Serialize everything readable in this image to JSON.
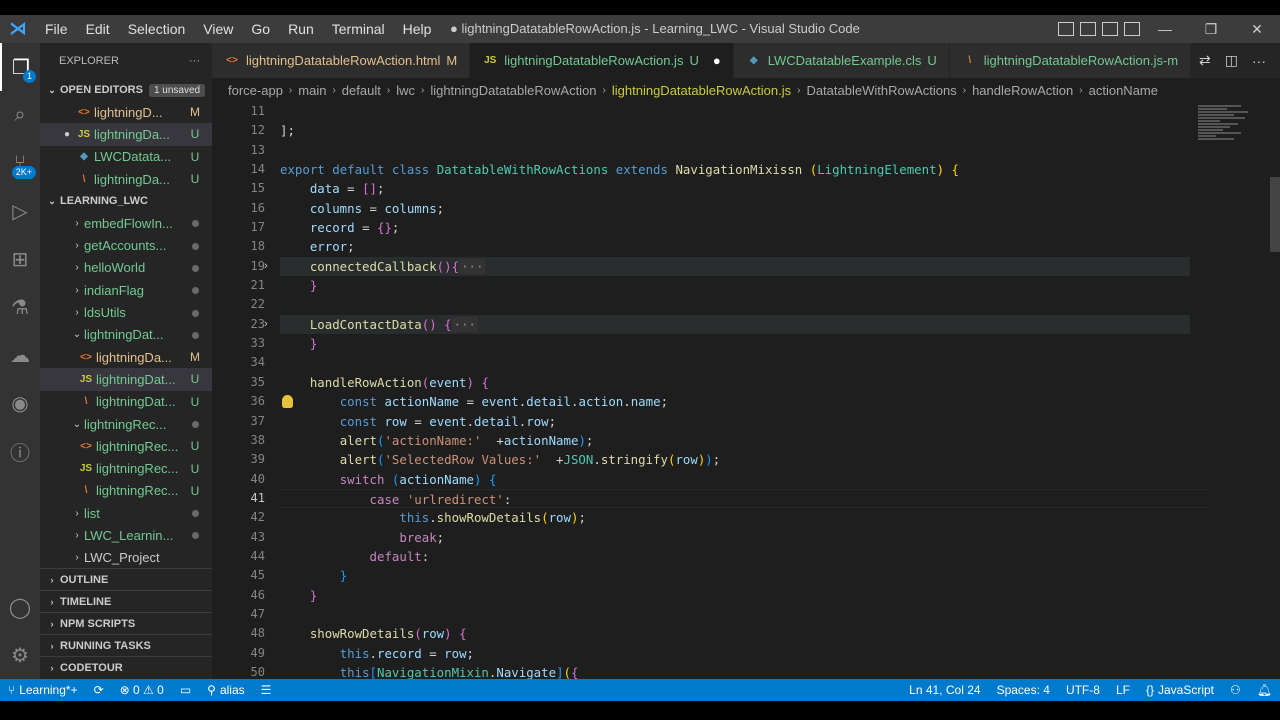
{
  "titlebar": {
    "menu": [
      "File",
      "Edit",
      "Selection",
      "View",
      "Go",
      "Run",
      "Terminal",
      "Help"
    ],
    "title": "● lightningDatatableRowAction.js - Learning_LWC - Visual Studio Code",
    "controls": [
      "—",
      "❐",
      "✕"
    ]
  },
  "activity": {
    "badges": [
      "1",
      "2K+"
    ]
  },
  "sidebar": {
    "header": "EXPLORER",
    "more": "···",
    "open_editors": {
      "label": "OPEN EDITORS",
      "badge": "1 unsaved",
      "items": [
        {
          "icon": "<>",
          "type": "html",
          "name": "lightningD...",
          "status": "M"
        },
        {
          "icon": "JS",
          "type": "js",
          "name": "lightningDa...",
          "status": "U",
          "dirty": "●"
        },
        {
          "icon": "◆",
          "type": "cls",
          "name": "LWCDatata...",
          "status": "U"
        },
        {
          "icon": "\\",
          "type": "xml",
          "name": "lightningDa...",
          "status": "U"
        }
      ]
    },
    "workspace": {
      "label": "LEARNING_LWC",
      "items": [
        {
          "chev": "›",
          "name": "embedFlowIn...",
          "status": "dot",
          "depth": 1
        },
        {
          "chev": "›",
          "name": "getAccounts...",
          "status": "dot",
          "depth": 1
        },
        {
          "chev": "›",
          "name": "helloWorld",
          "status": "dot",
          "depth": 1
        },
        {
          "chev": "›",
          "name": "indianFlag",
          "status": "dot",
          "depth": 1
        },
        {
          "chev": "›",
          "name": "ldsUtils",
          "status": "dot",
          "depth": 1
        },
        {
          "chev": "⌄",
          "name": "lightningDat...",
          "status": "dot",
          "depth": 1
        },
        {
          "icon": "<>",
          "type": "html",
          "name": "lightningDa...",
          "status": "M",
          "depth": 2
        },
        {
          "icon": "JS",
          "type": "js",
          "name": "lightningDat...",
          "status": "U",
          "depth": 2,
          "selected": true
        },
        {
          "icon": "\\",
          "type": "xml",
          "name": "lightningDat...",
          "status": "U",
          "depth": 2
        },
        {
          "chev": "⌄",
          "name": "lightningRec...",
          "status": "dot",
          "depth": 1
        },
        {
          "icon": "<>",
          "type": "html",
          "name": "lightningRec...",
          "status": "U",
          "depth": 2
        },
        {
          "icon": "JS",
          "type": "js",
          "name": "lightningRec...",
          "status": "U",
          "depth": 2
        },
        {
          "icon": "\\",
          "type": "xml",
          "name": "lightningRec...",
          "status": "U",
          "depth": 2
        },
        {
          "chev": "›",
          "name": "list",
          "status": "dot",
          "depth": 1
        },
        {
          "chev": "›",
          "name": "LWC_Learnin...",
          "status": "dot",
          "depth": 1
        },
        {
          "chev": "›",
          "name": "LWC_Project",
          "status": "",
          "depth": 1
        }
      ]
    },
    "bottom_sections": [
      "OUTLINE",
      "TIMELINE",
      "NPM SCRIPTS",
      "RUNNING TASKS",
      "CODETOUR"
    ]
  },
  "tabs": [
    {
      "icon": "<>",
      "type": "html",
      "label": "lightningDatatableRowAction.html",
      "flag": "M",
      "active": false
    },
    {
      "icon": "JS",
      "type": "js",
      "label": "lightningDatatableRowAction.js",
      "flag": "U",
      "dirty": "●",
      "active": true
    },
    {
      "icon": "◆",
      "type": "cls",
      "label": "LWCDatatableExample.cls",
      "flag": "U",
      "active": false
    },
    {
      "icon": "\\",
      "type": "xml",
      "label": "lightningDatatableRowAction.js-m",
      "flag": "",
      "active": false
    }
  ],
  "breadcrumbs": [
    "force-app",
    "main",
    "default",
    "lwc",
    "lightningDatatableRowAction",
    "lightningDatatableRowAction.js",
    "DatatableWithRowActions",
    "handleRowAction",
    "actionName"
  ],
  "editor": {
    "line_numbers": [
      "11",
      "12",
      "13",
      "14",
      "15",
      "16",
      "17",
      "18",
      "19",
      "21",
      "22",
      "23",
      "33",
      "34",
      "35",
      "36",
      "37",
      "38",
      "39",
      "40",
      "41",
      "42",
      "43",
      "44",
      "45",
      "46",
      "47",
      "48",
      "49",
      "50"
    ],
    "current_line": "41"
  },
  "status": {
    "branch": "Learning*+",
    "sync": "⟳",
    "problems": "⊗ 0 ⚠ 0",
    "alias": "alias",
    "position": "Ln 41, Col 24",
    "spaces": "Spaces: 4",
    "encoding": "UTF-8",
    "eol": "LF",
    "language": "JavaScript"
  }
}
